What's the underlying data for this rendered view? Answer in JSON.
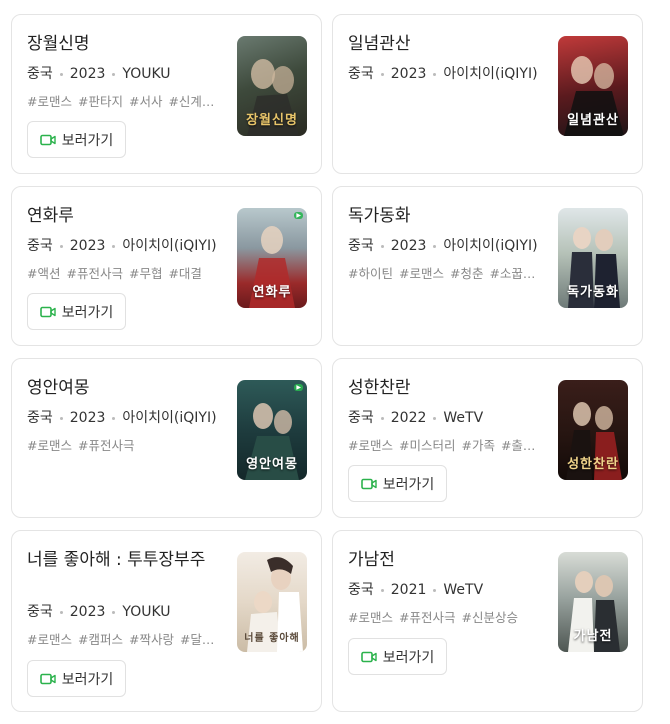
{
  "cards": [
    {
      "title": "장월신명",
      "country": "중국",
      "year": "2023",
      "platform": "YOUKU",
      "tags": [
        "#로맨스",
        "#판타지",
        "#서사",
        "#신계…"
      ],
      "watch_label": "보러가기",
      "poster_caption": "장월신명"
    },
    {
      "title": "일념관산",
      "country": "중국",
      "year": "2023",
      "platform": "아이치이(iQIYI)",
      "tags": [],
      "watch_label": "보러가기",
      "poster_caption": "일념관산"
    },
    {
      "title": "연화루",
      "country": "중국",
      "year": "2023",
      "platform": "아이치이(iQIYI)",
      "tags": [
        "#액션",
        "#퓨전사극",
        "#무협",
        "#대결"
      ],
      "watch_label": "보러가기",
      "poster_caption": "연화루"
    },
    {
      "title": "독가동화",
      "country": "중국",
      "year": "2023",
      "platform": "아이치이(iQIYI)",
      "tags": [
        "#하이틴",
        "#로맨스",
        "#청춘",
        "#소꿉…"
      ],
      "poster_caption": "독가동화"
    },
    {
      "title": "영안여몽",
      "country": "중국",
      "year": "2023",
      "platform": "아이치이(iQIYI)",
      "tags": [
        "#로맨스",
        "#퓨전사극"
      ],
      "poster_caption": "영안여몽"
    },
    {
      "title": "성한찬란",
      "country": "중국",
      "year": "2022",
      "platform": "WeTV",
      "tags": [
        "#로맨스",
        "#미스터리",
        "#가족",
        "#출…"
      ],
      "watch_label": "보러가기",
      "poster_caption": "성한찬란"
    },
    {
      "title": "너를 좋아해 : 투투장부주",
      "country": "중국",
      "year": "2023",
      "platform": "YOUKU",
      "tags": [
        "#로맨스",
        "#캠퍼스",
        "#짝사랑",
        "#달…"
      ],
      "watch_label": "보러가기",
      "poster_caption": "너를 좋아해"
    },
    {
      "title": "가남전",
      "country": "중국",
      "year": "2021",
      "platform": "WeTV",
      "tags": [
        "#로맨스",
        "#퓨전사극",
        "#신분상승"
      ],
      "watch_label": "보러가기",
      "poster_caption": "가남전"
    }
  ],
  "colors": {
    "watch_icon": "#2bb24c",
    "border": "#e4e4e4",
    "tag": "#888888"
  }
}
